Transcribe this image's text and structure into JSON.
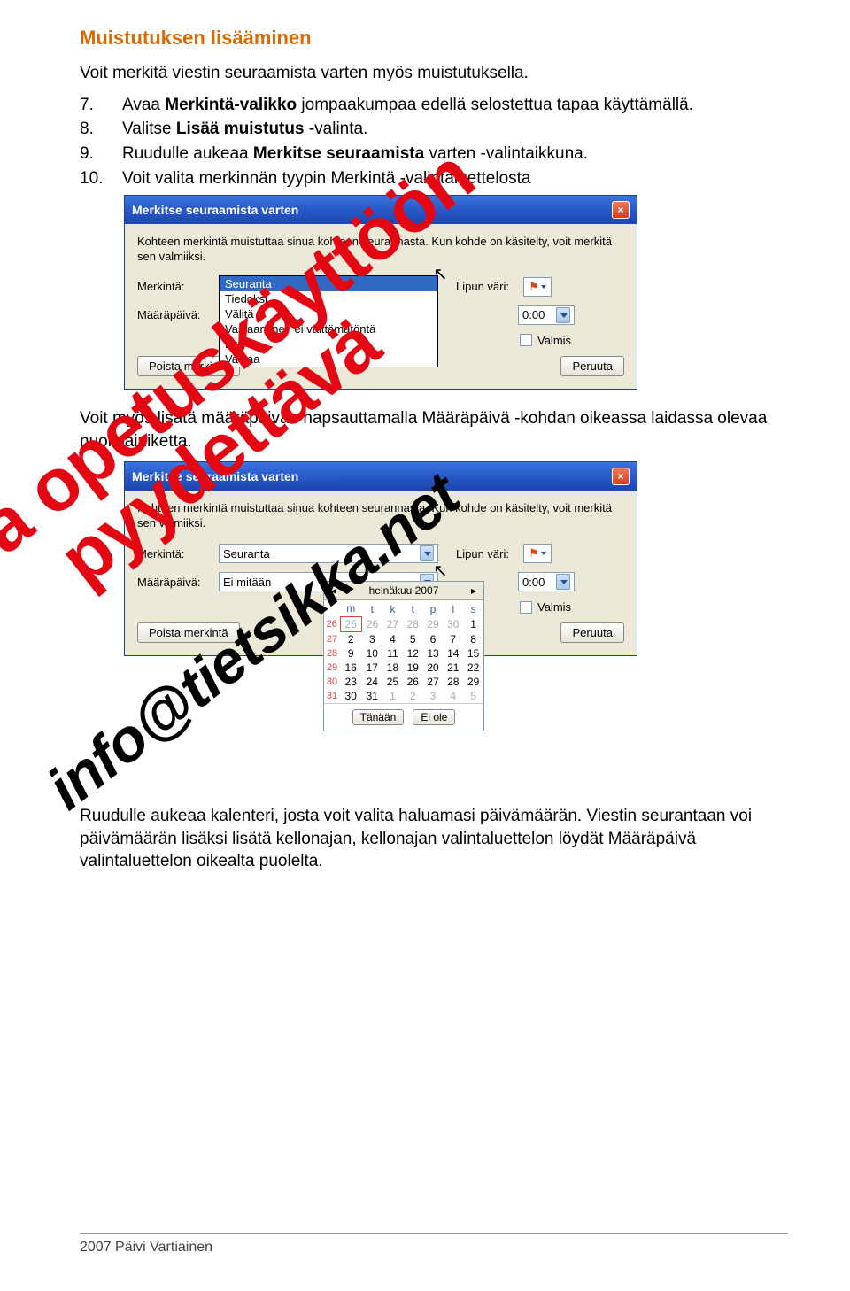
{
  "heading": "Muistutuksen lisääminen",
  "intro": "Voit merkitä viestin seuraamista varten myös muistutuksella.",
  "steps": [
    {
      "n": "7.",
      "before": "Avaa ",
      "bold": "Merkintä-valikko",
      "after": " jompaakumpaa edellä selostettua tapaa käyttämällä."
    },
    {
      "n": "8.",
      "before": "Valitse ",
      "bold": "Lisää muistutus",
      "after": " -valinta."
    },
    {
      "n": "9.",
      "before": "Ruudulle aukeaa ",
      "bold": "Merkitse seuraamista",
      "after": " varten -valintaikkuna."
    },
    {
      "n": "10.",
      "before": "Voit valita merkinnän tyypin Merkintä -valintaluettelosta",
      "bold": "",
      "after": ""
    }
  ],
  "dialog": {
    "title": "Merkitse seuraamista varten",
    "hint": "Kohteen merkintä muistuttaa sinua kohteen seurannasta. Kun kohde on käsitelty, voit merkitä sen valmiiksi.",
    "label_merkinta": "Merkintä:",
    "label_maara": "Määräpäivä:",
    "label_lipun": "Lipun väri:",
    "label_valmis": "Valmis",
    "btn_poista": "Poista merkintä",
    "btn_peruuta": "Peruuta",
    "merkinta_value": "Seuranta",
    "maara_value": "Ei mitään",
    "time_value": "0:00",
    "options": [
      "Seuranta",
      "Tiedoksi",
      "Välitä",
      "Vastaaminen ei välttämätöntä",
      "Lue",
      "Vastaa"
    ]
  },
  "mid_para": "Voit myös lisätä määräpäivän napsauttamalla Määräpäivä -kohdan oikeassa laidassa olevaa nuolipainiketta.",
  "calendar": {
    "month": "heinäkuu 2007",
    "weekdays": [
      "m",
      "t",
      "k",
      "t",
      "p",
      "l",
      "s"
    ],
    "btn_today": "Tänään",
    "btn_none": "Ei ole",
    "rows": [
      {
        "wk": "26",
        "cells": [
          {
            "d": "25",
            "g": true,
            "t": true
          },
          {
            "d": "26",
            "g": true
          },
          {
            "d": "27",
            "g": true
          },
          {
            "d": "28",
            "g": true
          },
          {
            "d": "29",
            "g": true
          },
          {
            "d": "30",
            "g": true
          },
          {
            "d": "1"
          }
        ]
      },
      {
        "wk": "27",
        "cells": [
          {
            "d": "2"
          },
          {
            "d": "3"
          },
          {
            "d": "4"
          },
          {
            "d": "5"
          },
          {
            "d": "6"
          },
          {
            "d": "7"
          },
          {
            "d": "8"
          }
        ]
      },
      {
        "wk": "28",
        "cells": [
          {
            "d": "9"
          },
          {
            "d": "10"
          },
          {
            "d": "11"
          },
          {
            "d": "12"
          },
          {
            "d": "13"
          },
          {
            "d": "14"
          },
          {
            "d": "15"
          }
        ]
      },
      {
        "wk": "29",
        "cells": [
          {
            "d": "16"
          },
          {
            "d": "17"
          },
          {
            "d": "18"
          },
          {
            "d": "19"
          },
          {
            "d": "20"
          },
          {
            "d": "21"
          },
          {
            "d": "22"
          }
        ]
      },
      {
        "wk": "30",
        "cells": [
          {
            "d": "23"
          },
          {
            "d": "24"
          },
          {
            "d": "25"
          },
          {
            "d": "26"
          },
          {
            "d": "27"
          },
          {
            "d": "28"
          },
          {
            "d": "29"
          }
        ]
      },
      {
        "wk": "31",
        "cells": [
          {
            "d": "30"
          },
          {
            "d": "31"
          },
          {
            "d": "1",
            "g": true
          },
          {
            "d": "2",
            "g": true
          },
          {
            "d": "3",
            "g": true
          },
          {
            "d": "4",
            "g": true
          },
          {
            "d": "5",
            "g": true
          }
        ]
      }
    ]
  },
  "end_para": "Ruudulle aukeaa kalenteri, josta voit valita haluamasi päivämäärän. Viestin seurantaan voi päivämäärän lisäksi lisätä kellonajan, kellonajan valintaluettelon löydät Määräpäivä valintaluettelon oikealta puolelta.",
  "watermark1": "Lupa opetuskäyttöön pyydettävä",
  "watermark2": "info@tietsikka.net",
  "footer": "2007 Päivi Vartiainen"
}
